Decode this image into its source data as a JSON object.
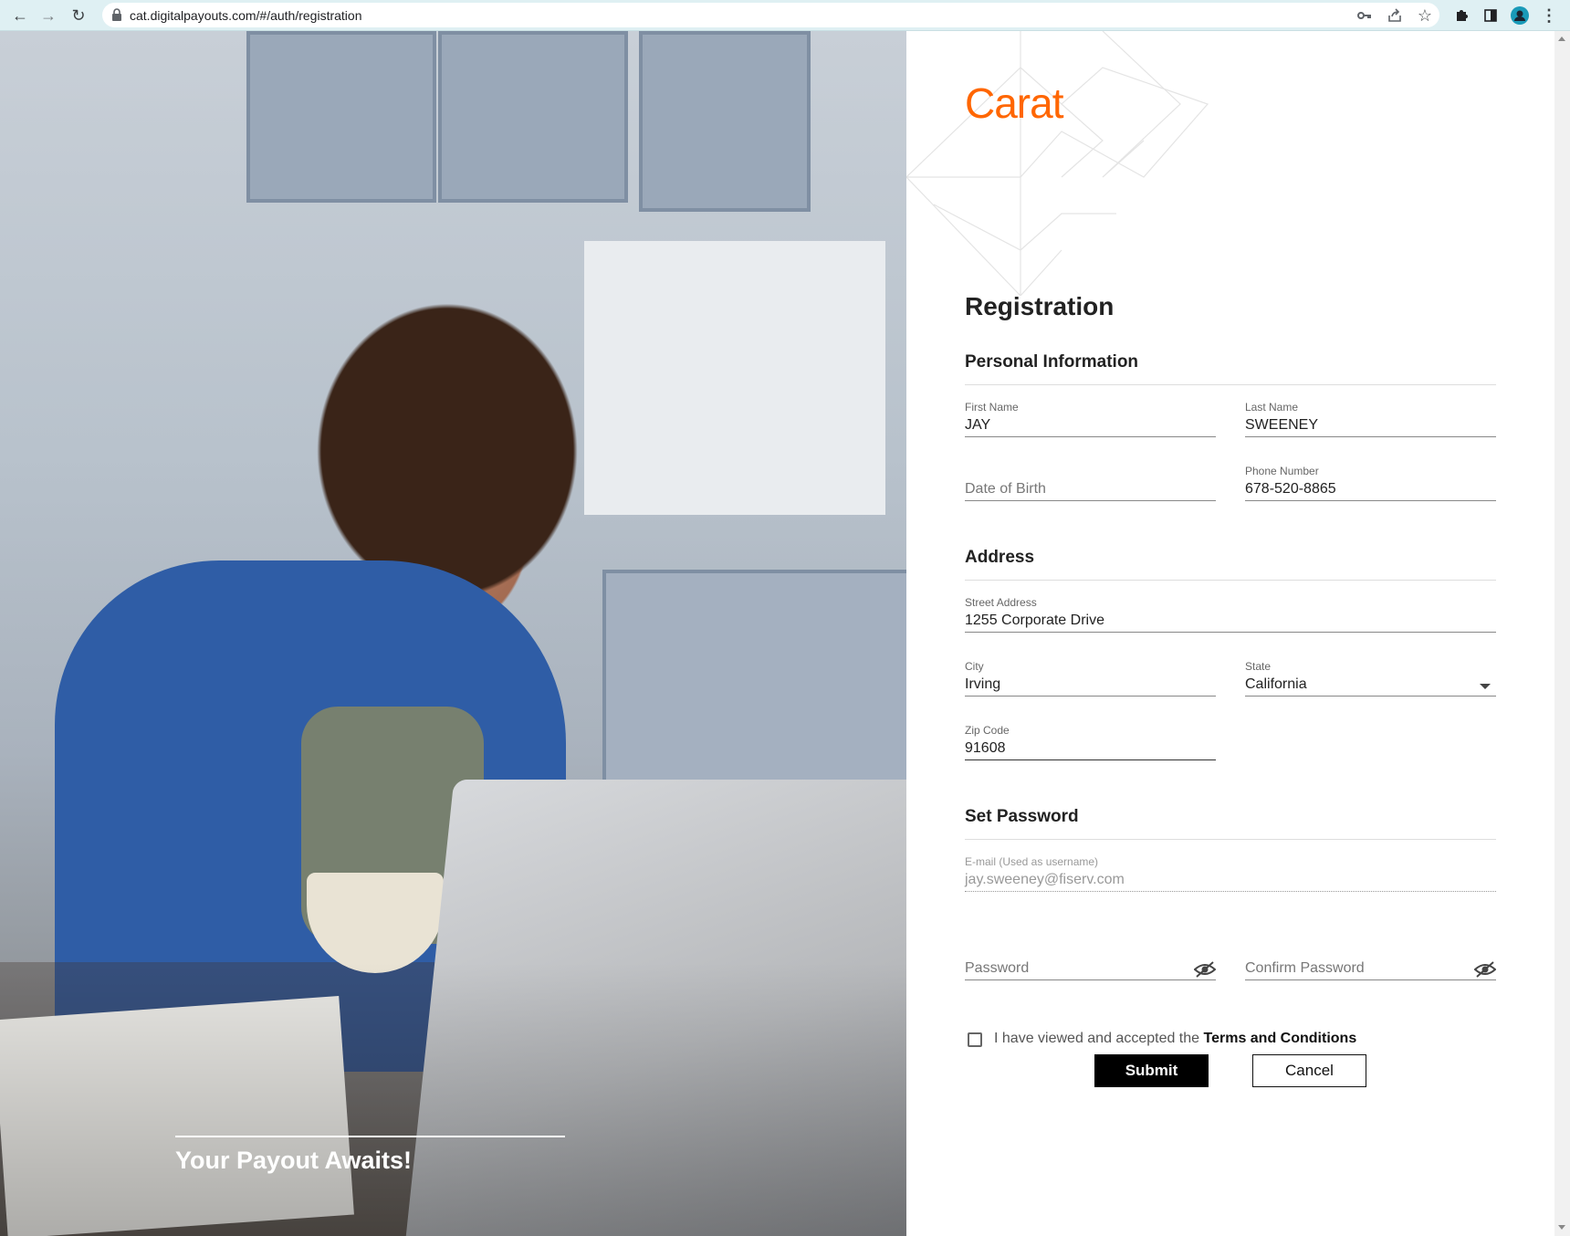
{
  "browser": {
    "url": "cat.digitalpayouts.com/#/auth/registration"
  },
  "hero": {
    "tagline": "Your Payout Awaits!"
  },
  "brand": {
    "logo_text": "Carat",
    "accent_color": "#ff6600"
  },
  "form": {
    "title": "Registration",
    "personal": {
      "heading": "Personal Information",
      "first_name": {
        "label": "First Name",
        "value": "JAY"
      },
      "last_name": {
        "label": "Last Name",
        "value": "SWEENEY"
      },
      "dob": {
        "placeholder": "Date of Birth"
      },
      "phone": {
        "label": "Phone Number",
        "value": "678-520-8865"
      }
    },
    "address": {
      "heading": "Address",
      "street": {
        "label": "Street Address",
        "value": "1255 Corporate Drive"
      },
      "city": {
        "label": "City",
        "value": "Irving"
      },
      "state": {
        "label": "State",
        "value": "California"
      },
      "zip": {
        "label": "Zip Code",
        "value": "91608"
      }
    },
    "password": {
      "heading": "Set Password",
      "email": {
        "label": "E-mail (Used as username)",
        "value": "jay.sweeney@fiserv.com"
      },
      "password": {
        "placeholder": "Password"
      },
      "confirm": {
        "placeholder": "Confirm Password"
      }
    },
    "terms": {
      "prefix": "I have viewed and accepted the ",
      "link": "Terms and Conditions"
    },
    "submit_label": "Submit",
    "cancel_label": "Cancel"
  }
}
